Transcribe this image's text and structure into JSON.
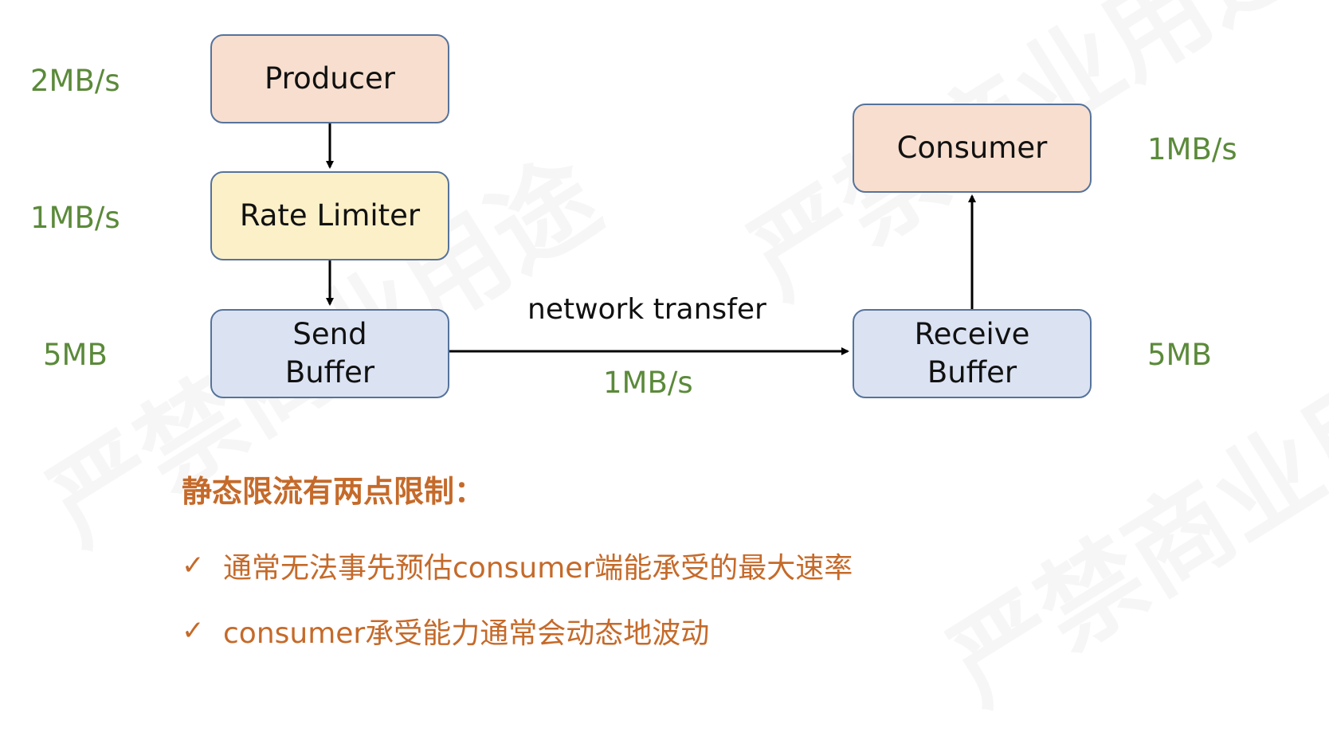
{
  "diagram": {
    "nodes": {
      "producer": "Producer",
      "rate_limiter": "Rate Limiter",
      "send_buffer": "Send Buffer",
      "consumer": "Consumer",
      "receive_buffer": "Receive Buffer"
    },
    "rates": {
      "producer": "2MB/s",
      "rate_limiter": "1MB/s",
      "send_buffer": "5MB",
      "consumer": "1MB/s",
      "receive_buffer": "5MB"
    },
    "network": {
      "label": "network transfer",
      "rate": "1MB/s"
    }
  },
  "notes": {
    "heading": "静态限流有两点限制：",
    "bullets": [
      "通常无法事先预估consumer端能承受的最大速率",
      "consumer承受能力通常会动态地波动"
    ],
    "bullet_icon": "check-icon"
  },
  "watermark": "严禁商业用途",
  "colors": {
    "box_border": "#56739c",
    "peach": "#f7dece",
    "yellow": "#fcf0c8",
    "blue": "#dbe3f3",
    "rate_text": "#5b8a3a",
    "notes_text": "#c56a2a"
  }
}
